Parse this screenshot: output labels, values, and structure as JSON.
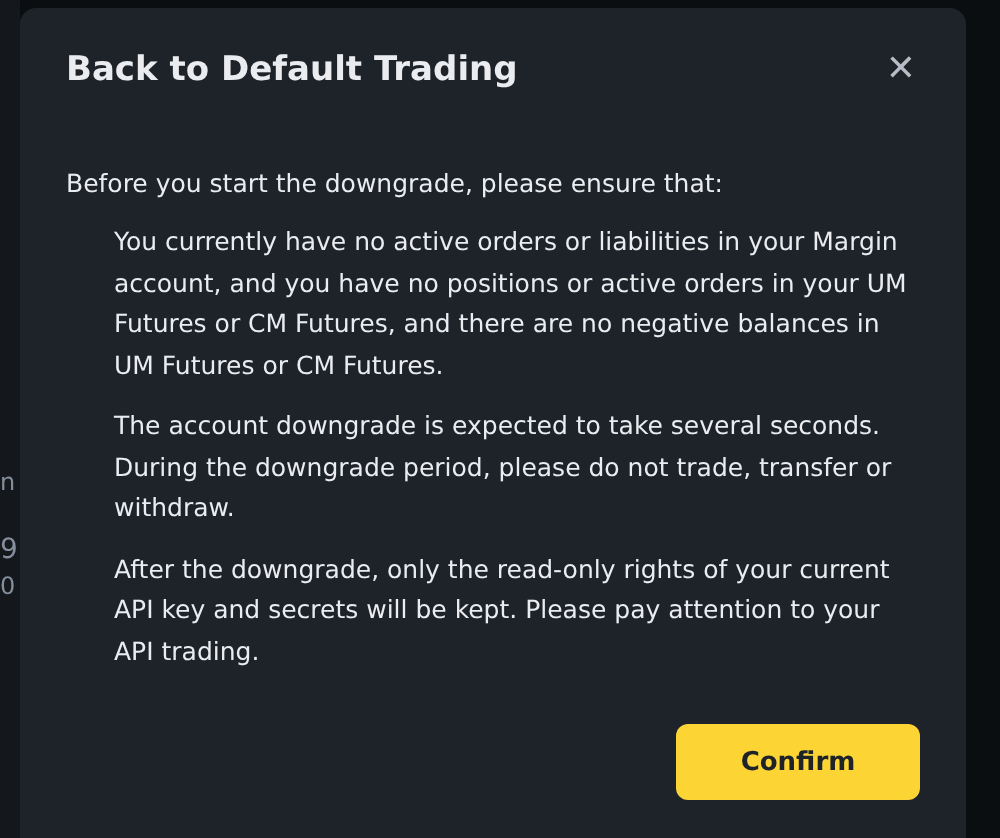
{
  "background_fragments": [
    "n",
    "9",
    "0"
  ],
  "dialog": {
    "title": "Back to Default Trading",
    "close": "✕",
    "intro": "Before you start the downgrade, please ensure that:",
    "points": [
      "You currently have no active orders or liabilities in your Margin account, and you have no positions or active orders in your UM Futures or CM Futures, and there are no negative balances in UM Futures or CM Futures.",
      "The account downgrade is expected to take several seconds. During the downgrade period, please do not trade, transfer or withdraw.",
      "After the downgrade, only the read-only rights of your current API key and secrets will be kept. Please pay attention to your API trading."
    ],
    "confirm": "Confirm"
  }
}
